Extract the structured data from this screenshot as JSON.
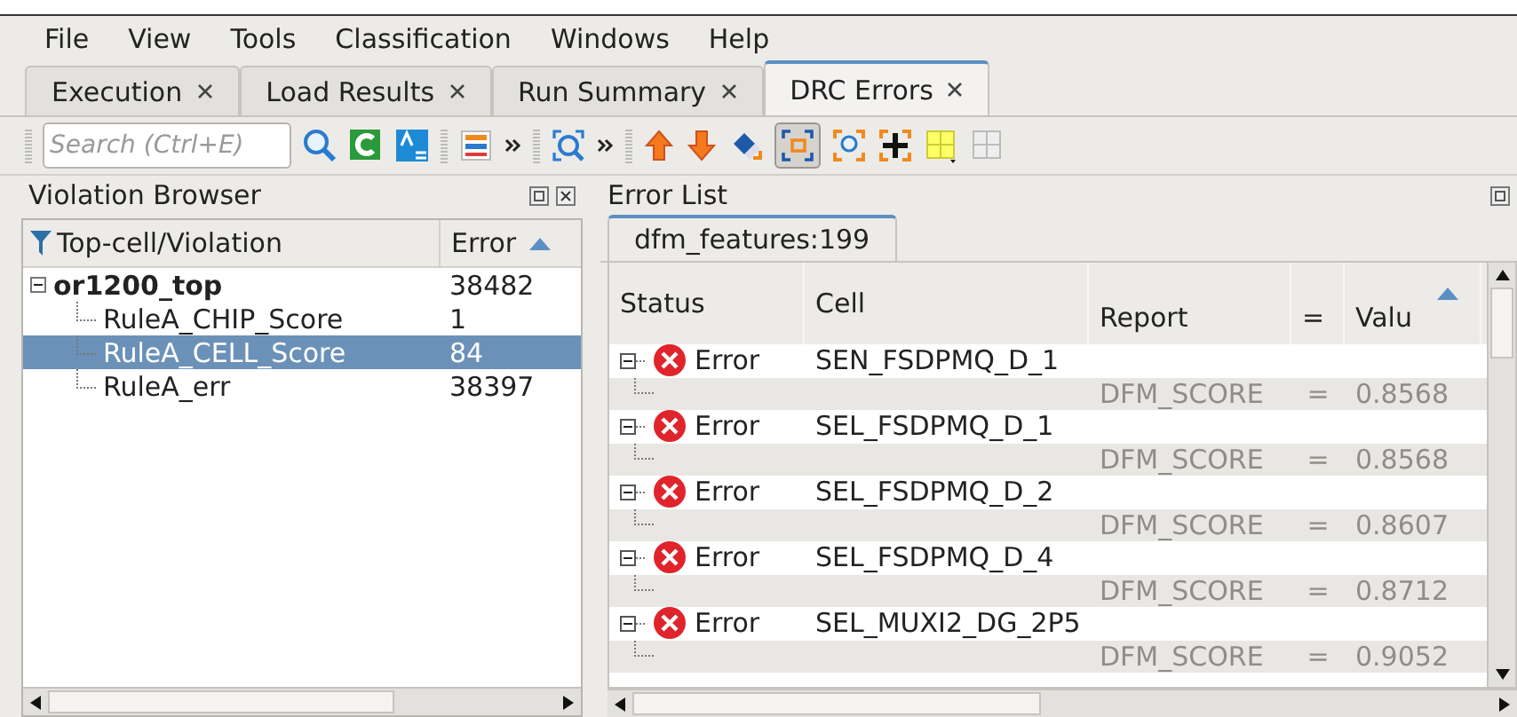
{
  "menu": [
    "File",
    "View",
    "Tools",
    "Classification",
    "Windows",
    "Help"
  ],
  "tabs": [
    {
      "label": "Execution",
      "selected": false
    },
    {
      "label": "Load Results",
      "selected": false
    },
    {
      "label": "Run Summary",
      "selected": false
    },
    {
      "label": "DRC Errors",
      "selected": true
    }
  ],
  "toolbar": {
    "search_placeholder": "Search (Ctrl+E)"
  },
  "violation_browser": {
    "title": "Violation Browser",
    "columns": [
      {
        "label": "Top-cell/Violation",
        "sorted": false
      },
      {
        "label": "Error",
        "sorted": true
      }
    ],
    "tree": [
      {
        "label": "or1200_top",
        "count": "38482",
        "expanded": true,
        "selected": false,
        "children": [
          {
            "label": "RuleA_CHIP_Score",
            "count": "1",
            "selected": false
          },
          {
            "label": "RuleA_CELL_Score",
            "count": "84",
            "selected": true
          },
          {
            "label": "RuleA_err",
            "count": "38397",
            "selected": false
          }
        ]
      }
    ]
  },
  "error_list": {
    "title": "Error List",
    "tab": "dfm_features:199",
    "columns": [
      {
        "label": "Status",
        "sorted": false
      },
      {
        "label": "Cell",
        "sorted": false
      },
      {
        "label": "Report",
        "sorted": false
      },
      {
        "label": "=",
        "sorted": false
      },
      {
        "label": "Valu",
        "sorted": true
      }
    ],
    "rows": [
      {
        "status": "Error",
        "cell": "SEN_FSDPMQ_D_1",
        "expanded": true,
        "report": "DFM_SCORE",
        "op": "=",
        "value": "0.8568"
      },
      {
        "status": "Error",
        "cell": "SEL_FSDPMQ_D_1",
        "expanded": true,
        "report": "DFM_SCORE",
        "op": "=",
        "value": "0.8568"
      },
      {
        "status": "Error",
        "cell": "SEL_FSDPMQ_D_2",
        "expanded": true,
        "report": "DFM_SCORE",
        "op": "=",
        "value": "0.8607"
      },
      {
        "status": "Error",
        "cell": "SEL_FSDPMQ_D_4",
        "expanded": true,
        "report": "DFM_SCORE",
        "op": "=",
        "value": "0.8712"
      },
      {
        "status": "Error",
        "cell": "SEL_MUXI2_DG_2P5",
        "expanded": true,
        "report": "DFM_SCORE",
        "op": "=",
        "value": "0.9052"
      }
    ]
  }
}
